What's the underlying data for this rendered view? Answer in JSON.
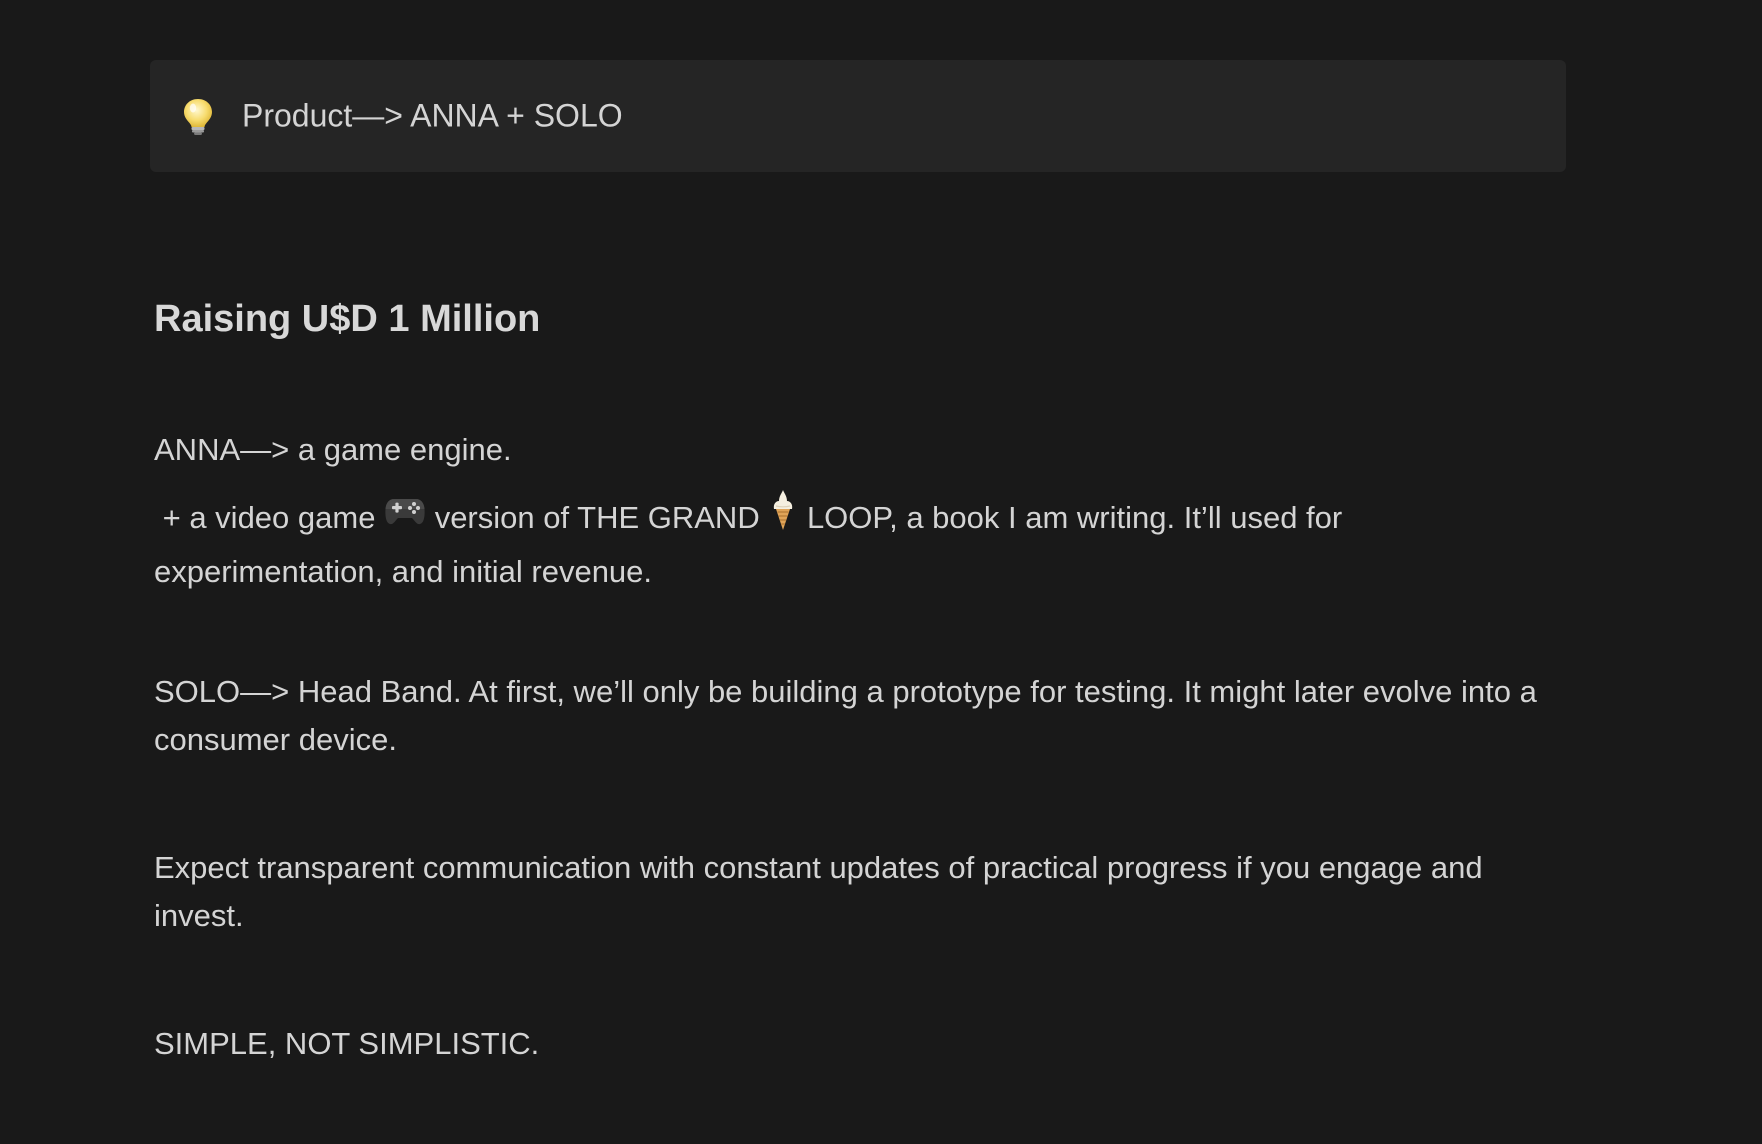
{
  "callout": {
    "icon": "lightbulb-icon",
    "text": "Product—> ANNA + SOLO"
  },
  "heading": "Raising U$D 1 Million",
  "paragraphs": {
    "anna": "ANNA—> a game engine.",
    "game_part1": " + a video game ",
    "game_icon": "gamepad-icon",
    "game_part2": " version of THE GRAND ",
    "icecream_icon": "ice-cream-icon",
    "game_part3": " LOOP, a book I am writing. It’ll used for experimentation, and initial revenue.",
    "solo": "SOLO—> Head Band. At first, we’ll only be building a prototype for testing. It might later evolve into a consumer device.",
    "expect": "Expect transparent communication with constant updates of practical progress if you engage and invest.",
    "simple": "SIMPLE, NOT SIMPLISTIC."
  },
  "colors": {
    "background": "#191919",
    "callout_background": "#252525",
    "text": "#d4d4d4"
  }
}
